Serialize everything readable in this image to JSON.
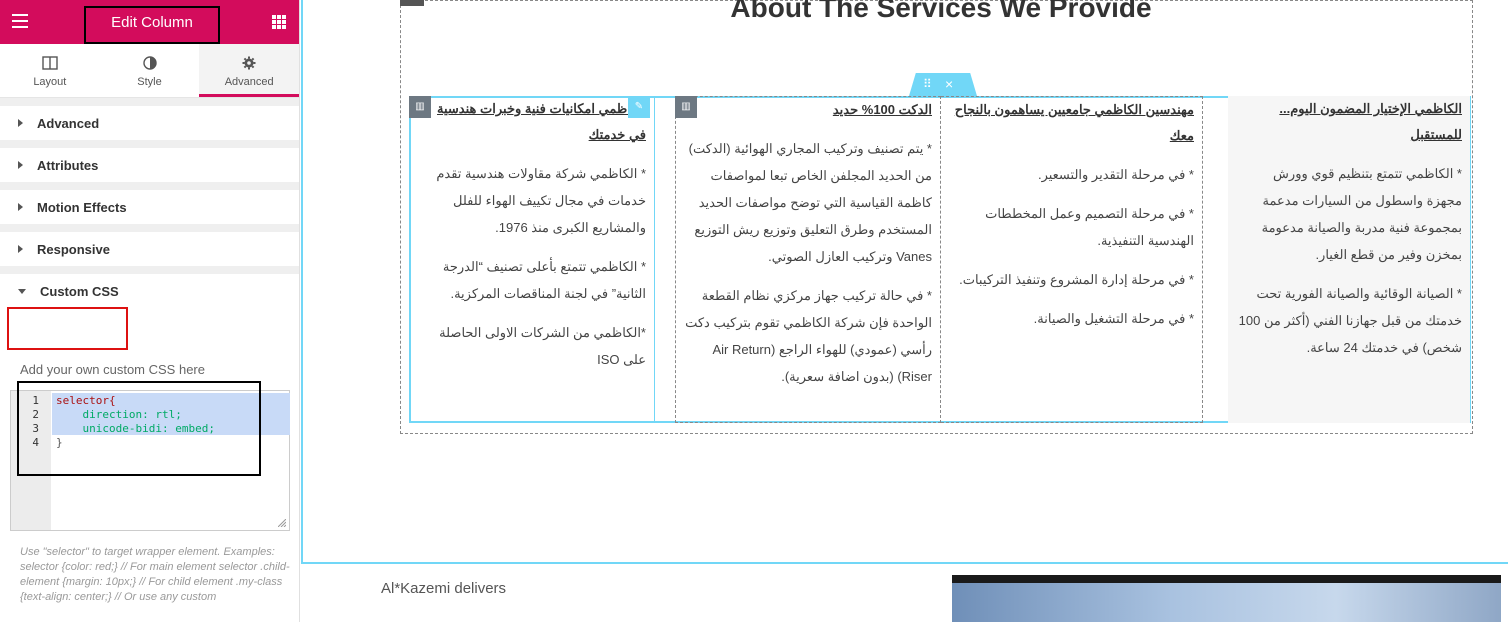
{
  "panel": {
    "title": "Edit Column",
    "tabs": [
      {
        "label": "Layout",
        "icon": "columns-icon"
      },
      {
        "label": "Style",
        "icon": "half-circle-icon"
      },
      {
        "label": "Advanced",
        "icon": "gear-icon"
      }
    ],
    "sections": [
      "Advanced",
      "Attributes",
      "Motion Effects",
      "Responsive",
      "Custom CSS"
    ],
    "custom_css_hint": "Add your own custom CSS here",
    "code_lines": [
      {
        "num": "1",
        "text": "selector{"
      },
      {
        "num": "2",
        "text": "    direction: rtl;"
      },
      {
        "num": "3",
        "text": "    unicode-bidi: embed;"
      },
      {
        "num": "4",
        "text": "}"
      }
    ],
    "footer_help": "Use \"selector\" to target wrapper element. Examples: selector {color: red;} // For main element selector .child-element {margin: 10px;} // For child element .my-class {text-align: center;} // Or use any custom"
  },
  "canvas": {
    "heading": "About The Services We Provide",
    "columns": [
      {
        "heading": "الكاظمي الإختيار المضمون اليوم... للمستقبل",
        "paragraphs": [
          "* الكاظمي تتمتع بتنظيم قوي وورش مجهزة واسطول من السيارات مدعمة بمجموعة فنية مدربة والصيانة مدعومة بمخزن وفير من قطع الغيار.",
          "* الصيانة الوقائية والصيانة الفورية تحت خدمتك من قبل جهازنا الفني (أكثر من 100 شخص) في خدمتك 24 ساعة."
        ]
      },
      {
        "heading": "مهندسين الكاظمي جامعيين يساهمون بالنجاح معك",
        "paragraphs": [
          "* في مرحلة التقدير والتسعير.",
          "* في مرحلة التصميم وعمل المخططات الهندسية التنفيذية.",
          "* في مرحلة إدارة المشروع وتنفيذ التركيبات.",
          "* في مرحلة التشغيل والصيانة."
        ]
      },
      {
        "heading": "الدكت 100% حديد",
        "paragraphs": [
          "* يتم تصنيف وتركيب المجاري الهوائية (الدكت) من الحديد المجلفن الخاص تبعا لمواصفات كاظمة القياسية التي توضح مواصفات الحديد المستخدم وطرق التعليق وتوزيع ريش التوزيع Vanes وتركيب العازل الصوتي.",
          "* في حالة تركيب جهاز مركزي نظام القطعة الواحدة فإن شركة الكاظمي تقوم بتركيب دكت رأسي (عمودي) للهواء الراجع (Air Return Riser) (بدون اضافة سعرية)."
        ]
      },
      {
        "heading": "الكاظمي امكانيات فنية وخبرات هندسية في خدمتك",
        "paragraphs": [
          "* الكاظمي شركة مقاولات هندسية تقدم خدمات في مجال تكييف الهواء للفلل والمشاريع الكبرى منذ 1976.",
          "* الكاظمي تتمتع بأعلى تصنيف “الدرجة الثانية” في لجنة المناقصات المركزية.",
          "*الكاظمي من الشركات الاولى الحاصلة على ISO"
        ]
      }
    ],
    "below_text": "Al*Kazemi delivers"
  }
}
